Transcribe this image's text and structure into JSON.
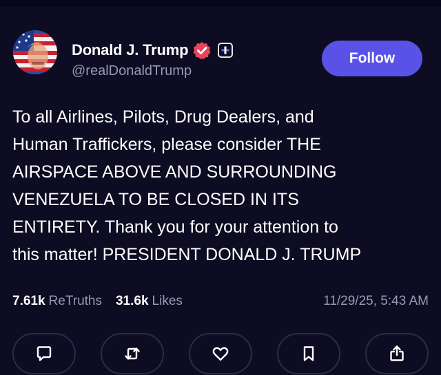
{
  "author": {
    "display_name": "Donald J. Trump",
    "handle": "@realDonaldTrump",
    "verified": true,
    "avatar": "american-flag-portrait"
  },
  "follow_button": {
    "label": "Follow"
  },
  "post": {
    "lines": [
      "To all Airlines, Pilots, Drug Dealers, and",
      "Human Traffickers, please consider THE",
      "AIRSPACE ABOVE AND SURROUNDING",
      "VENEZUELA TO BE CLOSED IN ITS",
      "ENTIRETY. Thank you for your attention to",
      "this matter! PRESIDENT DONALD J. TRUMP"
    ]
  },
  "stats": {
    "retruths_count": "7.61k",
    "retruths_label": "ReTruths",
    "likes_count": "31.6k",
    "likes_label": "Likes",
    "timestamp": "11/29/25, 5:43 AM"
  },
  "actions": {
    "items": [
      "reply-icon",
      "retruth-icon",
      "heart-icon",
      "bookmark-icon",
      "share-icon"
    ]
  },
  "colors": {
    "background": "#0d0c22",
    "accent": "#5a52e6",
    "verified_badge": "#e8455a",
    "muted_text": "#9a99b5",
    "button_border": "#2c2b48"
  }
}
